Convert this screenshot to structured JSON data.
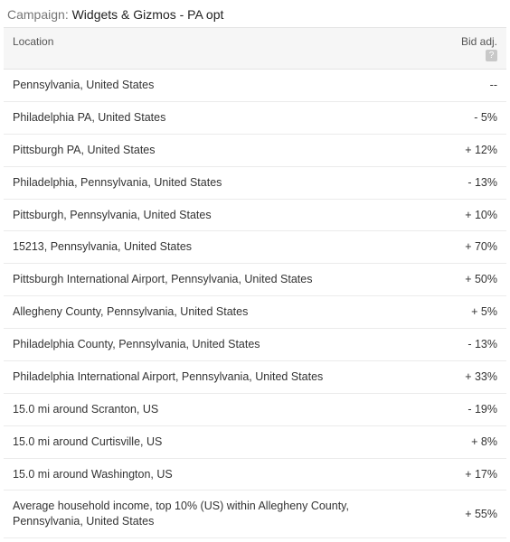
{
  "header": {
    "label": "Campaign:",
    "name": "Widgets & Gizmos - PA opt"
  },
  "columns": {
    "location": "Location",
    "bid_adj": "Bid adj."
  },
  "help_icon_glyph": "?",
  "rows": [
    {
      "location": "Pennsylvania, United States",
      "bid_adj": "--"
    },
    {
      "location": "Philadelphia PA, United States",
      "bid_adj": "- 5%"
    },
    {
      "location": "Pittsburgh PA, United States",
      "bid_adj": "+ 12%"
    },
    {
      "location": "Philadelphia, Pennsylvania, United States",
      "bid_adj": "- 13%"
    },
    {
      "location": "Pittsburgh, Pennsylvania, United States",
      "bid_adj": "+ 10%"
    },
    {
      "location": "15213, Pennsylvania, United States",
      "bid_adj": "+ 70%"
    },
    {
      "location": "Pittsburgh International Airport, Pennsylvania, United States",
      "bid_adj": "+ 50%"
    },
    {
      "location": "Allegheny County, Pennsylvania, United States",
      "bid_adj": "+ 5%"
    },
    {
      "location": "Philadelphia County, Pennsylvania, United States",
      "bid_adj": "- 13%"
    },
    {
      "location": "Philadelphia International Airport, Pennsylvania, United States",
      "bid_adj": "+ 33%"
    },
    {
      "location": "15.0 mi around Scranton, US",
      "bid_adj": "- 19%"
    },
    {
      "location": "15.0 mi around Curtisville, US",
      "bid_adj": "+ 8%"
    },
    {
      "location": "15.0 mi around Washington, US",
      "bid_adj": "+ 17%"
    },
    {
      "location": "Average household income, top 10% (US) within Allegheny County, Pennsylvania, United States",
      "bid_adj": "+ 55%"
    }
  ]
}
